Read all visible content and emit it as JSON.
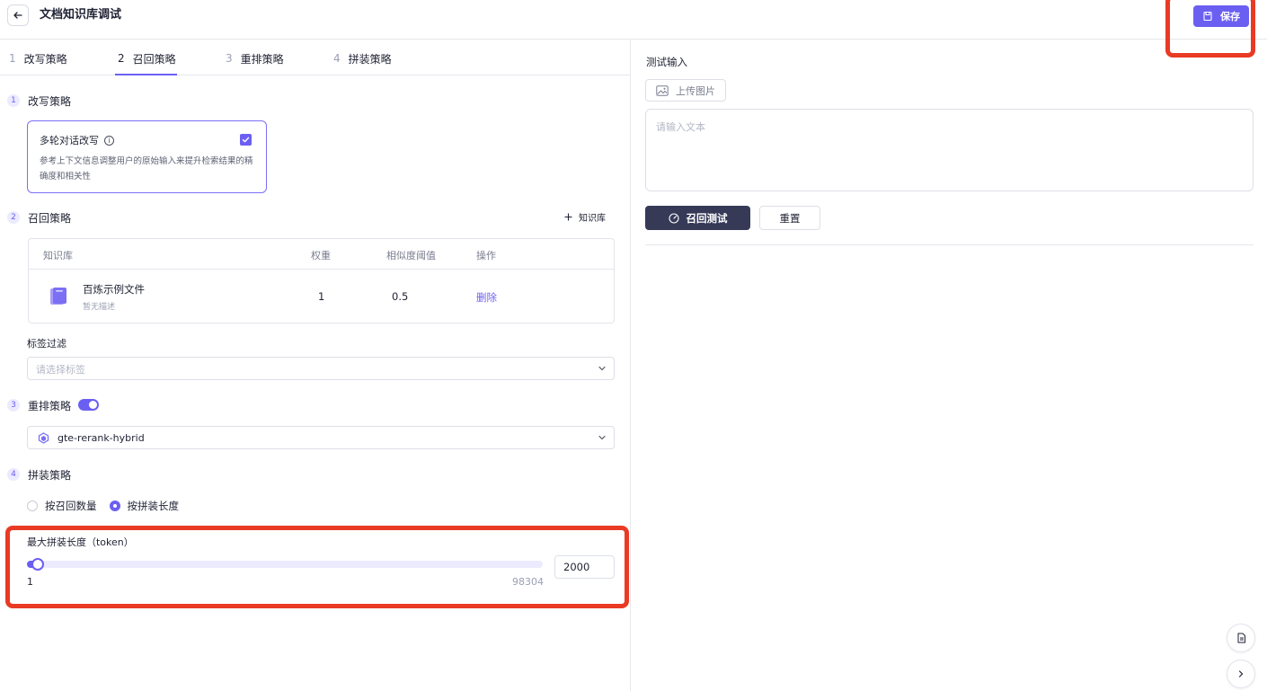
{
  "header": {
    "title": "文档知识库调试",
    "save_label": "保存"
  },
  "tabs": [
    {
      "num": "1",
      "label": "改写策略"
    },
    {
      "num": "2",
      "label": "召回策略"
    },
    {
      "num": "3",
      "label": "重排策略"
    },
    {
      "num": "4",
      "label": "拼装策略"
    }
  ],
  "rewrite": {
    "num": "1",
    "title": "改写策略",
    "card_title": "多轮对话改写",
    "card_desc": "参考上下文信息调整用户的原始输入来提升检索结果的精确度和相关性",
    "checked": true
  },
  "recall": {
    "num": "2",
    "title": "召回策略",
    "add_label": "知识库",
    "columns": [
      "知识库",
      "权重",
      "相似度阈值",
      "操作"
    ],
    "rows": [
      {
        "name": "百炼示例文件",
        "desc": "暂无描述",
        "weight": "1",
        "threshold": "0.5",
        "action": "删除"
      }
    ],
    "tag_filter_label": "标签过滤",
    "tag_filter_placeholder": "请选择标签"
  },
  "rerank": {
    "num": "3",
    "title": "重排策略",
    "enabled": true,
    "model": "gte-rerank-hybrid"
  },
  "assemble": {
    "num": "4",
    "title": "拼装策略",
    "options": [
      "按召回数量",
      "按拼装长度"
    ],
    "selected": "按拼装长度",
    "max_len_label": "最大拼装长度（token）",
    "min": "1",
    "max": "98304",
    "value": "2000"
  },
  "test": {
    "label": "测试输入",
    "upload_label": "上传图片",
    "input_placeholder": "请输入文本",
    "recall_test_label": "召回测试",
    "reset_label": "重置"
  },
  "colors": {
    "accent": "#6b5ff2",
    "dark_button": "#363a57",
    "annotation_red": "#e93a24"
  }
}
